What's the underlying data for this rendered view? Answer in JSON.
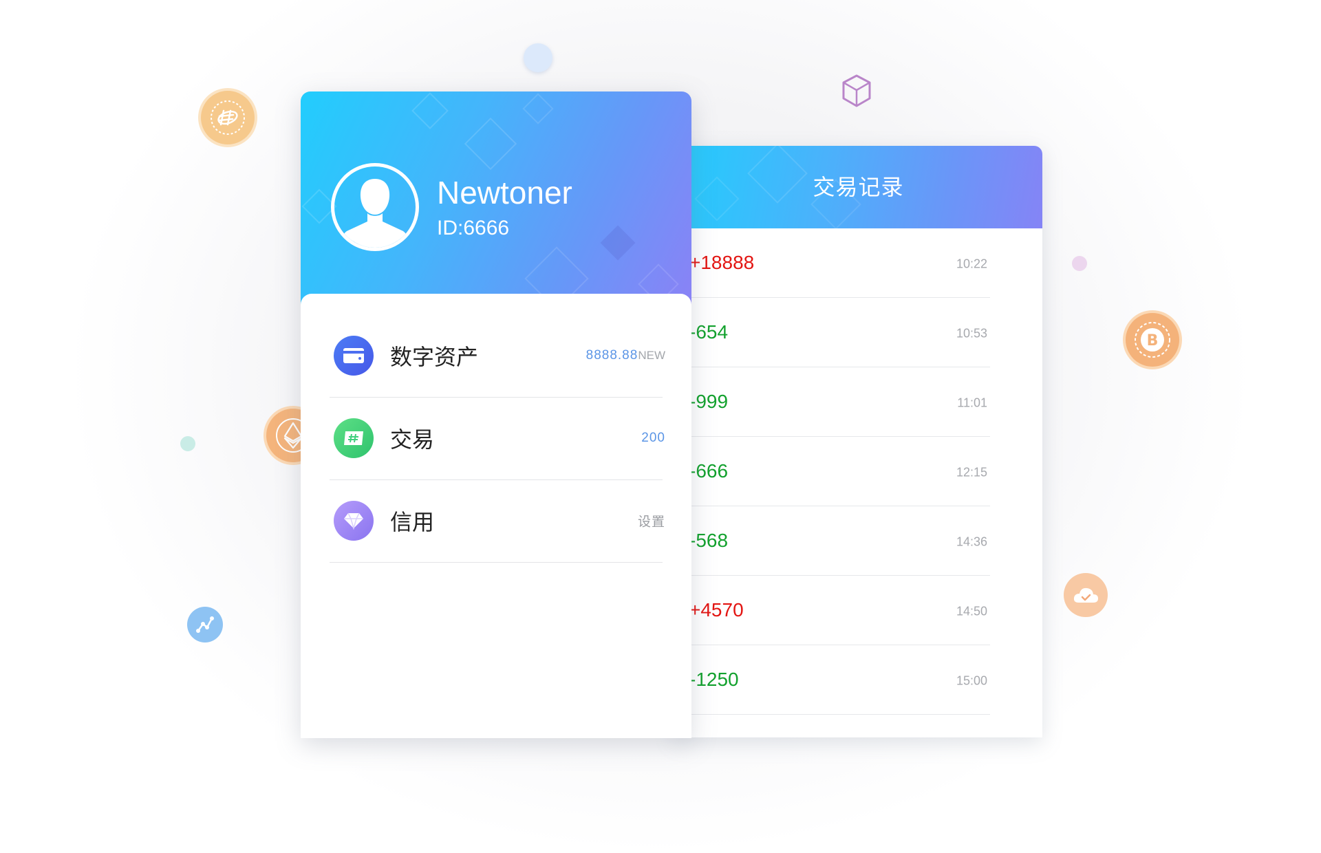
{
  "profile": {
    "name": "Newtoner",
    "id_text": "ID:6666",
    "menu": [
      {
        "label": "数字资产",
        "value": "8888.88",
        "badge": "NEW",
        "icon": "wallet-card-icon",
        "color": "#4f62ef"
      },
      {
        "label": "交易",
        "value": "200",
        "badge": "",
        "icon": "hash-ticket-icon",
        "color": "#3ecf7c"
      },
      {
        "label": "信用",
        "value": "设置",
        "badge": "",
        "icon": "diamond-icon",
        "color": "#9b7ff4"
      }
    ]
  },
  "transactions": {
    "title": "交易记录",
    "records": [
      {
        "amount": "+18888",
        "time": "10:22",
        "sign": "positive"
      },
      {
        "amount": "-654",
        "time": "10:53",
        "sign": "negative"
      },
      {
        "amount": "-999",
        "time": "11:01",
        "sign": "negative"
      },
      {
        "amount": "-666",
        "time": "12:15",
        "sign": "negative"
      },
      {
        "amount": "-568",
        "time": "14:36",
        "sign": "negative"
      },
      {
        "amount": "+4570",
        "time": "14:50",
        "sign": "positive"
      },
      {
        "amount": "-1250",
        "time": "15:00",
        "sign": "negative"
      }
    ]
  },
  "colors": {
    "positive": "#e31512",
    "negative": "#12a12d",
    "accent": "#5b95e6",
    "header_gradient_start": "#22cdfd",
    "header_gradient_end": "#8a82f6"
  },
  "decorations": [
    "hash-coin-icon",
    "ethereum-coin-icon",
    "bitcoin-coin-icon",
    "cube-icon",
    "cloud-check-icon",
    "network-graph-icon",
    "bubble-dot"
  ]
}
